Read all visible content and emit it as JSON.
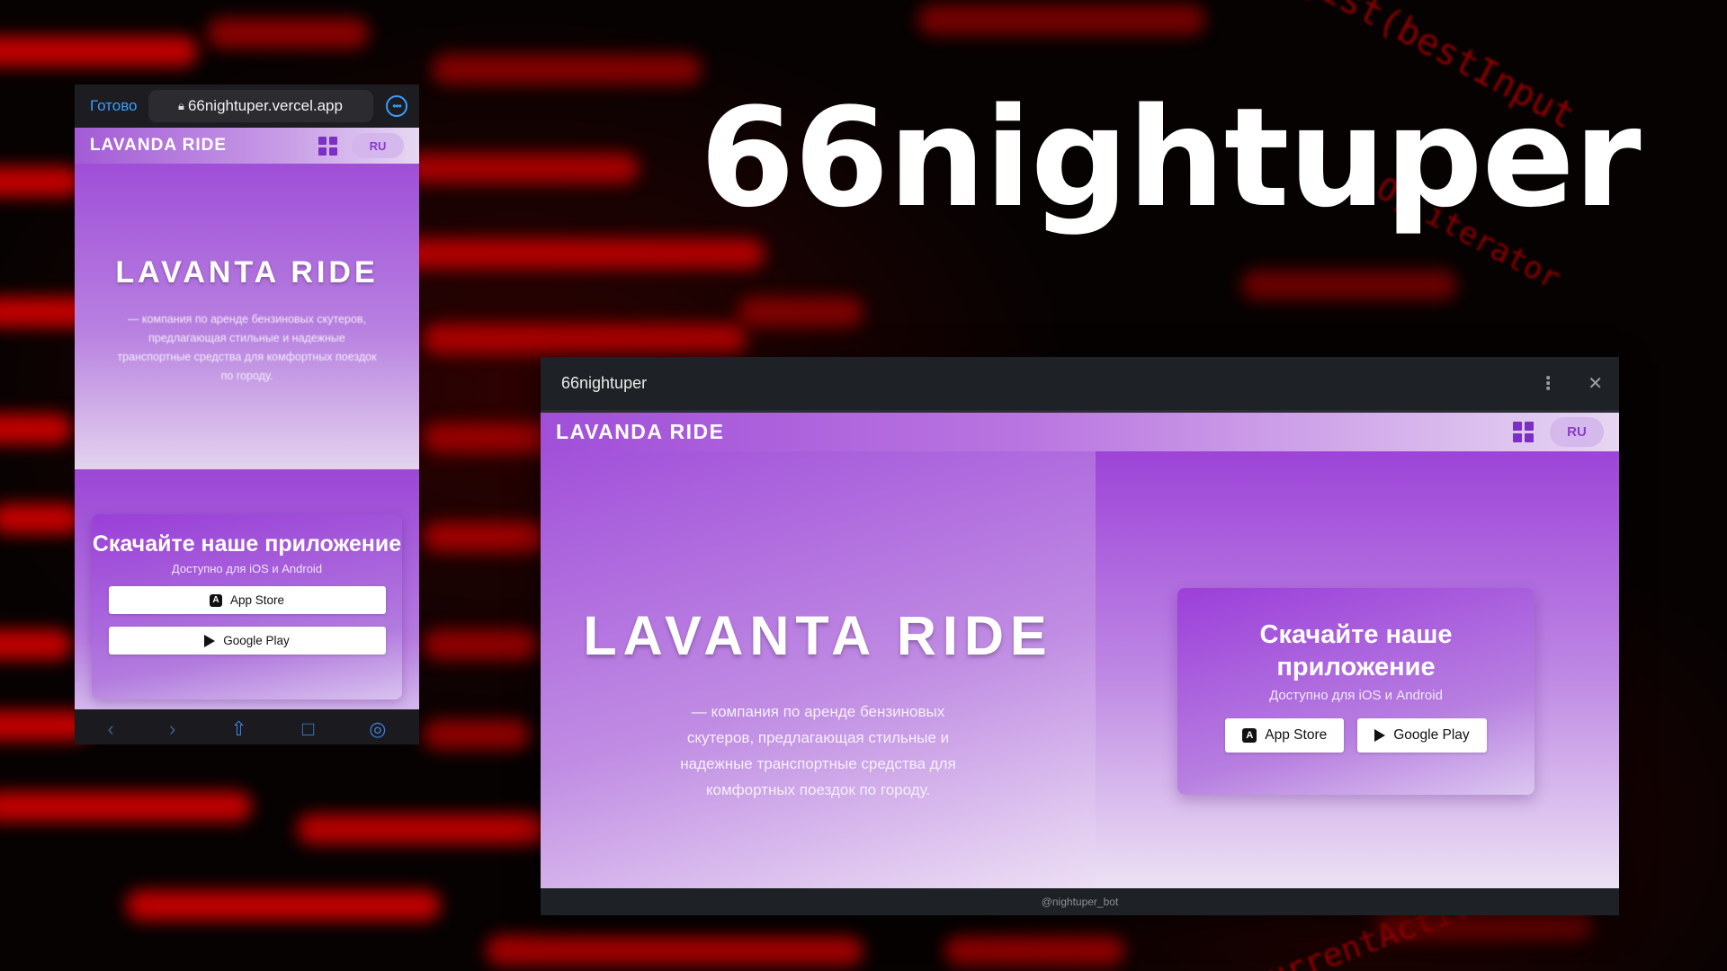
{
  "headline": "66nightuper",
  "phone": {
    "done_label": "Готово",
    "url": "66nightuper.vercel.app",
    "brand": "LAVANDA RIDE",
    "lang": "RU",
    "hero_title": "LAVANTA RIDE",
    "hero_description": "— компания по аренде бензиновых скутеров, предлагающая стильные и надежные транспортные средства для комфортных поездок по городу.",
    "download_title": "Скачайте наше приложение",
    "download_subtitle": "Доступно для iOS и Android",
    "app_store_label": "App Store",
    "google_play_label": "Google Play",
    "toolbar_icons": [
      "back-icon",
      "forward-icon",
      "share-icon",
      "bookmarks-icon",
      "compass-icon"
    ]
  },
  "window": {
    "title": "66nightuper",
    "brand": "LAVANDA RIDE",
    "lang": "RU",
    "hero_title": "LAVANTA RIDE",
    "hero_description": "— компания по аренде бензиновых скутеров, предлагающая стильные и надежные транспортные средства для комфортных поездок по городу.",
    "download_title": "Скачайте наше приложение",
    "download_subtitle": "Доступно для iOS и Android",
    "app_store_label": "App Store",
    "google_play_label": "Google Play",
    "footer": "@nightuper_bot"
  },
  "colors": {
    "accent_purple": "#9b47d6",
    "grid_icon": "#7b2fc4",
    "ios_blue": "#3b9cff",
    "background_red": "#e00000"
  }
}
